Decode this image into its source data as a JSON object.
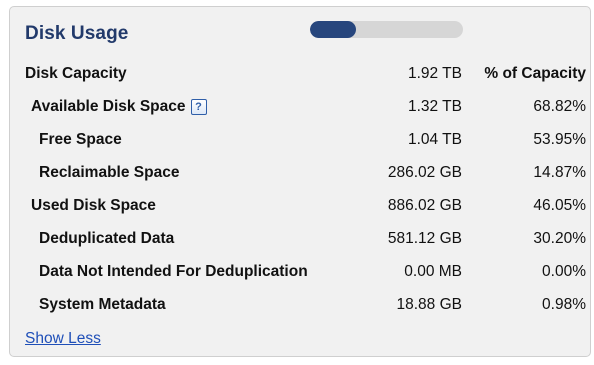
{
  "panel": {
    "title": "Disk Usage",
    "usage_fraction": 0.3,
    "colors": {
      "title": "#223a6b",
      "bar_fill": "#27467d",
      "bar_track": "#d6d6d6",
      "link": "#1f4fb8"
    }
  },
  "table": {
    "header": {
      "label": "Disk Capacity",
      "value": "1.92 TB",
      "pct": "% of Capacity"
    },
    "rows": [
      {
        "label": "Available Disk Space",
        "value": "1.32 TB",
        "pct": "68.82%"
      },
      {
        "label": "Free Space",
        "value": "1.04 TB",
        "pct": "53.95%"
      },
      {
        "label": "Reclaimable Space",
        "value": "286.02 GB",
        "pct": "14.87%"
      },
      {
        "label": "Used Disk Space",
        "value": "886.02 GB",
        "pct": "46.05%"
      },
      {
        "label": "Deduplicated Data",
        "value": "581.12 GB",
        "pct": "30.20%"
      },
      {
        "label": "Data Not Intended For Deduplication",
        "value": "0.00 MB",
        "pct": "0.00%"
      },
      {
        "label": "System Metadata",
        "value": "18.88 GB",
        "pct": "0.98%"
      }
    ],
    "help_icon": {
      "icon": "help-icon",
      "glyph": "?"
    }
  },
  "footer": {
    "toggle_label": "Show Less"
  }
}
